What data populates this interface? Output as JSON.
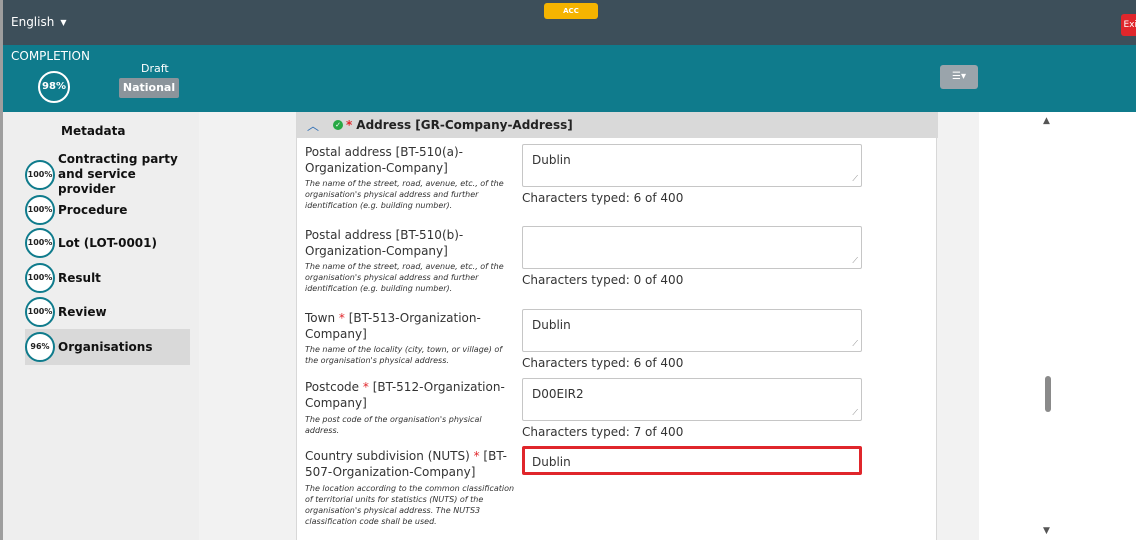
{
  "topbar": {
    "language": "English",
    "env_badge": "ACC",
    "exit_label": "Exit"
  },
  "status": {
    "completion_label": "COMPLETION",
    "completion_pct": "98%",
    "draft_label": "Draft",
    "scope_label": "National",
    "filter_icon": "sliders-icon"
  },
  "sidebar": {
    "items": [
      {
        "pct": "",
        "label": "Metadata"
      },
      {
        "pct": "100%",
        "label": "Contracting party and service provider"
      },
      {
        "pct": "100%",
        "label": "Procedure"
      },
      {
        "pct": "100%",
        "label": "Lot (LOT-0001)"
      },
      {
        "pct": "100%",
        "label": "Result"
      },
      {
        "pct": "100%",
        "label": "Review"
      },
      {
        "pct": "96%",
        "label": "Organisations"
      }
    ]
  },
  "panel": {
    "title": "Address  [GR-Company-Address]",
    "fields": [
      {
        "label": "Postal address [BT-510(a)-Organization-Company]",
        "required": false,
        "description": "The name of the street, road, avenue, etc., of the organisation's physical address and further identification (e.g. building number).",
        "value": "Dublin",
        "counter": "Characters typed: 6 of 400"
      },
      {
        "label": "Postal address [BT-510(b)-Organization-Company]",
        "required": false,
        "description": "The name of the street, road, avenue, etc., of the organisation's physical address and further identification (e.g. building number).",
        "value": "",
        "counter": "Characters typed: 0 of 400"
      },
      {
        "label_a": "Town",
        "label_b": "[BT-513-Organization-Company]",
        "required": true,
        "description": "The name of the locality (city, town, or village) of the organisation's physical address.",
        "value": "Dublin",
        "counter": "Characters typed: 6 of 400"
      },
      {
        "label_a": "Postcode",
        "label_b": "[BT-512-Organization-Company]",
        "required": true,
        "description": "The post code of the organisation's physical address.",
        "value": "D00EIR2",
        "counter": "Characters typed: 7 of 400"
      },
      {
        "label_a": "Country subdivision (NUTS)",
        "label_b": "[BT-507-Organization-Company]",
        "required": true,
        "description": "The location according to the common classification of territorial units for statistics (NUTS) of the organisation's physical address. The NUTS3 classification code shall be used.",
        "value": "Dublin"
      }
    ]
  },
  "colors": {
    "topbar": "#3d4f5a",
    "teal": "#0f7b8c",
    "env": "#f5b400",
    "exit": "#e0262b",
    "highlight": "#e0262b",
    "check": "#27a844"
  }
}
